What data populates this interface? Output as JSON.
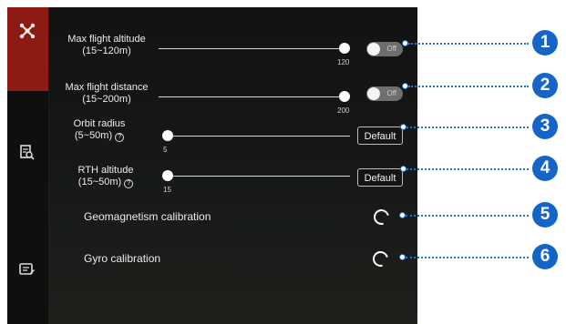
{
  "sidebar": {
    "items": [
      {
        "icon": "aircraft-icon",
        "active": true
      },
      {
        "icon": "document-search-icon",
        "active": false
      },
      {
        "icon": "settings-card-icon",
        "active": false
      }
    ]
  },
  "settings": {
    "max_altitude": {
      "label_line1": "Max flight altitude",
      "label_line2": "(15~120m)",
      "value": "120",
      "toggle_text": "Off"
    },
    "max_distance": {
      "label_line1": "Max flight distance",
      "label_line2": "(15~200m)",
      "value": "200",
      "toggle_text": "Off"
    },
    "orbit_radius": {
      "label_line1": "Orbit radius",
      "label_line2": "(5~50m)",
      "help": "?",
      "value": "5",
      "button": "Default"
    },
    "rth_altitude": {
      "label_line1": "RTH altitude",
      "label_line2": "(15~50m)",
      "help": "?",
      "value": "15",
      "button": "Default"
    },
    "geomagnetism": {
      "label": "Geomagnetism calibration"
    },
    "gyro": {
      "label": "Gyro calibration"
    }
  },
  "callouts": [
    "1",
    "2",
    "3",
    "4",
    "5",
    "6"
  ],
  "colors": {
    "accent_red": "#8e1a14",
    "callout_blue": "#1565c8"
  }
}
